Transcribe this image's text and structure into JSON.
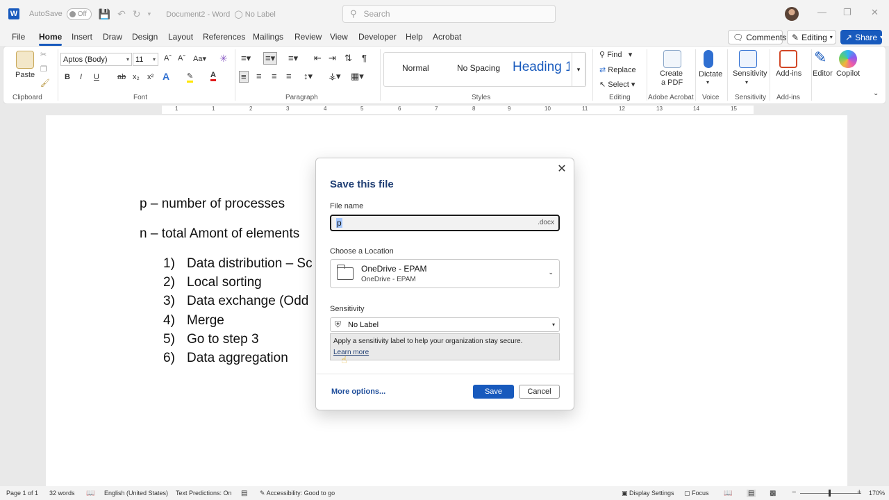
{
  "titlebar": {
    "autosave_label": "AutoSave",
    "autosave_state": "Off",
    "doc_title": "Document2",
    "app_name": "Word",
    "label_status": "No Label",
    "search_placeholder": "Search"
  },
  "menu": {
    "tabs": [
      "File",
      "Home",
      "Insert",
      "Draw",
      "Design",
      "Layout",
      "References",
      "Mailings",
      "Review",
      "View",
      "Developer",
      "Help",
      "Acrobat"
    ],
    "active": "Home",
    "comments": "Comments",
    "editing": "Editing",
    "share": "Share"
  },
  "ribbon": {
    "paste": "Paste",
    "font_name": "Aptos (Body)",
    "font_size": "11",
    "styles": [
      "Normal",
      "No Spacing",
      "Heading 1"
    ],
    "find": "Find",
    "replace": "Replace",
    "select": "Select",
    "create_pdf_1": "Create",
    "create_pdf_2": "a PDF",
    "dictate": "Dictate",
    "sensitivity": "Sensitivity",
    "addins": "Add-ins",
    "editor": "Editor",
    "copilot": "Copilot",
    "groups": {
      "clipboard": "Clipboard",
      "font": "Font",
      "paragraph": "Paragraph",
      "styles": "Styles",
      "editing": "Editing",
      "adobe": "Adobe Acrobat",
      "voice": "Voice",
      "sensitivity": "Sensitivity",
      "addins": "Add-ins"
    }
  },
  "ruler": [
    "1",
    "1",
    "2",
    "3",
    "4",
    "5",
    "6",
    "7",
    "8",
    "9",
    "10",
    "11",
    "12",
    "13",
    "14",
    "15",
    "16"
  ],
  "document": {
    "line1": "p – number of processes",
    "line2": "n – total Amont of elements",
    "list": [
      {
        "num": "1)",
        "text": "Data distribution – Sc"
      },
      {
        "num": "2)",
        "text": "Local sorting"
      },
      {
        "num": "3)",
        "text": "Data exchange (Odd"
      },
      {
        "num": "4)",
        "text": "Merge"
      },
      {
        "num": "5)",
        "text": "Go to step 3"
      },
      {
        "num": "6)",
        "text": "Data aggregation"
      }
    ]
  },
  "dialog": {
    "title": "Save this file",
    "file_name_label": "File name",
    "file_name_value": "p",
    "extension": ".docx",
    "location_label": "Choose a Location",
    "location_name": "OneDrive - EPAM",
    "location_sub": "OneDrive - EPAM",
    "sensitivity_label": "Sensitivity",
    "sensitivity_value": "No Label",
    "tip_text": "Apply a sensitivity label to help your organization stay secure.",
    "learn_more": "Learn more",
    "more_options": "More options...",
    "save": "Save",
    "cancel": "Cancel"
  },
  "status": {
    "page": "Page 1 of 1",
    "words": "32 words",
    "language": "English (United States)",
    "predictions": "Text Predictions: On",
    "accessibility": "Accessibility: Good to go",
    "display": "Display Settings",
    "focus": "Focus",
    "zoom": "170%"
  },
  "colors": {
    "accent": "#185abd",
    "dialog_title": "#1f3e73"
  }
}
